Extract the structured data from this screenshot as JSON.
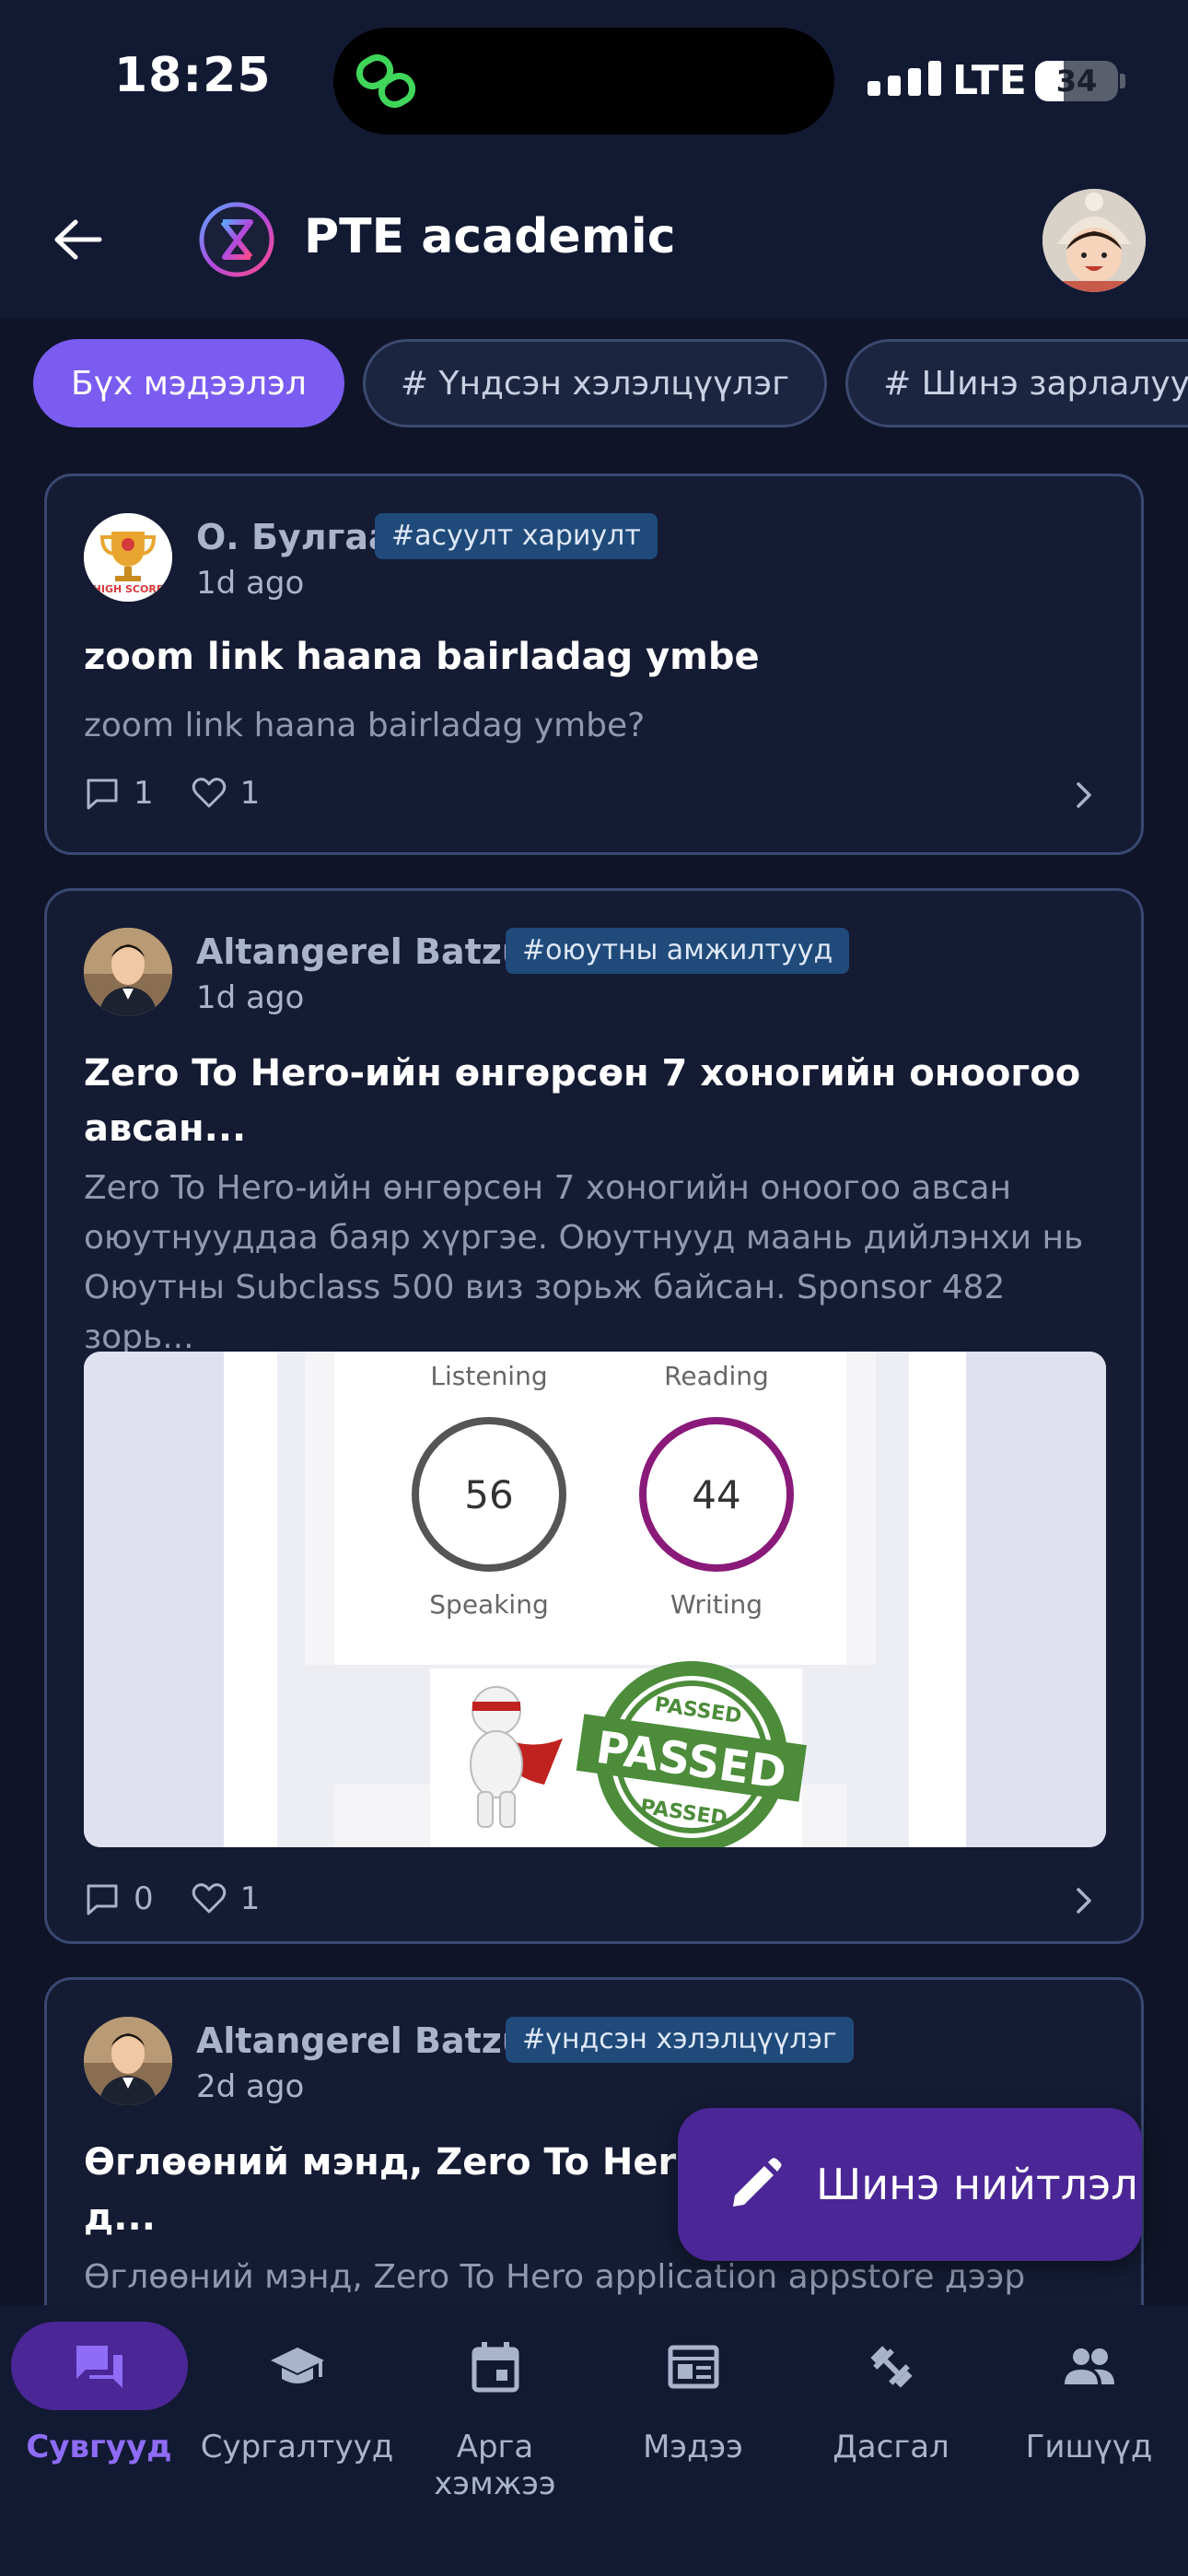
{
  "status_bar": {
    "time": "18:25",
    "network": "LTE",
    "battery": "34",
    "battery_percent": 34
  },
  "header": {
    "title": "PTE academic"
  },
  "chips": [
    {
      "label": "Бүх мэдээлэл",
      "active": true
    },
    {
      "label": "# Үндсэн хэлэлцүүлэг",
      "active": false
    },
    {
      "label": "# Шинэ зарлалууд",
      "active": false
    }
  ],
  "posts": [
    {
      "author": "О. Булгаа",
      "tag": "#асуулт хариулт",
      "time": "1d ago",
      "title": "zoom link haana bairladag ymbe",
      "excerpt": "zoom link haana bairladag ymbe?",
      "comments": "1",
      "likes": "1"
    },
    {
      "author": "Altangerel Batzul",
      "tag": "#оюутны амжилтууд",
      "time": "1d ago",
      "title_line1": "Zero To Hero-ийн өнгөрсөн 7 хоногийн оноогоо",
      "title_line2": "авсан...",
      "excerpt_line1": "Zero To Hero-ийн өнгөрсөн 7 хоногийн оноогоо авсан",
      "excerpt_line2": "оюутнууддаа баяр хүргэе.  Оюутнууд маань дийлэнхи нь",
      "excerpt_line3": "Оюутны Subclass 500 виз зорьж байсан. Sponsor 482 зорь...",
      "image": {
        "label_listening": "Listening",
        "label_reading": "Reading",
        "label_speaking": "Speaking",
        "label_writing": "Writing",
        "score_speaking": "56",
        "score_writing": "44",
        "stamp_text": "PASSED",
        "stamp_top": "PASSED",
        "stamp_bottom": "PASSED"
      },
      "comments": "0",
      "likes": "1"
    },
    {
      "author": "Altangerel Batzul",
      "tag": "#үндсэн хэлэлцүүлэг",
      "time": "2d ago",
      "title_line1": "Өглөөний мэнд, Zero To Hero a",
      "title_line2": "д...",
      "excerpt": "Өглөөний мэнд, Zero To Hero application appstore дээр"
    }
  ],
  "fab": {
    "label": "Шинэ нийтлэл"
  },
  "bottom_nav": [
    {
      "label": "Сувгууд",
      "icon": "forum-icon",
      "active": true
    },
    {
      "label": "Сургалтууд",
      "icon": "school-icon",
      "active": false
    },
    {
      "label": "Арга хэмжээ",
      "icon": "calendar-icon",
      "active": false
    },
    {
      "label": "Мэдээ",
      "icon": "news-icon",
      "active": false
    },
    {
      "label": "Дасгал",
      "icon": "dumbbell-icon",
      "active": false
    },
    {
      "label": "Гишүүд",
      "icon": "people-icon",
      "active": false
    }
  ],
  "colors": {
    "accent": "#7a5cf0",
    "fab": "#4b2696",
    "background": "#0f1428",
    "tag": "#1f4a7a"
  }
}
